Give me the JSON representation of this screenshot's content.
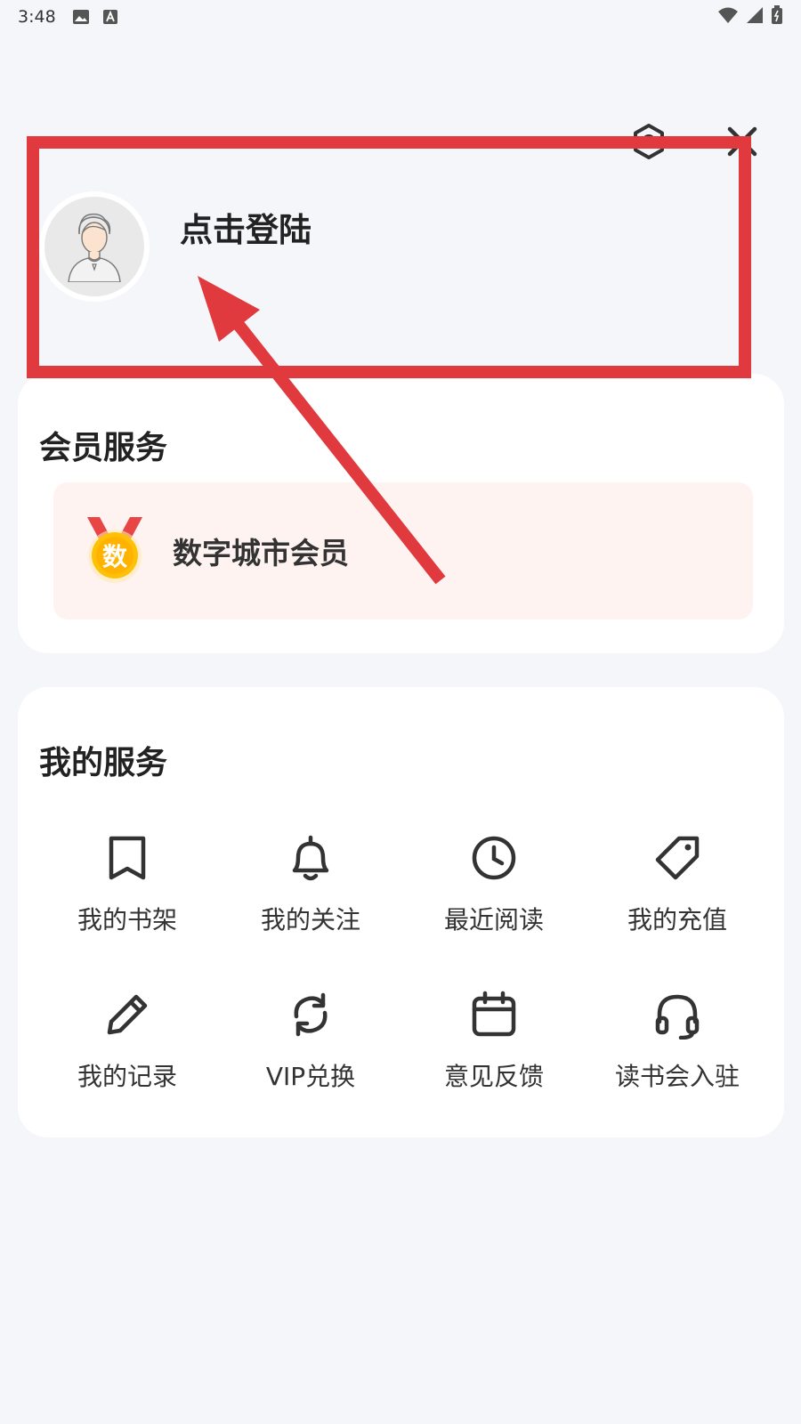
{
  "status_bar": {
    "time": "3:48"
  },
  "header": {
    "login_text": "点击登陆"
  },
  "member_section": {
    "title": "会员服务",
    "item_label": "数字城市会员",
    "medal_char": "数"
  },
  "services": {
    "title": "我的服务",
    "items": [
      {
        "label": "我的书架",
        "icon": "bookmark-icon"
      },
      {
        "label": "我的关注",
        "icon": "bell-icon"
      },
      {
        "label": "最近阅读",
        "icon": "clock-icon"
      },
      {
        "label": "我的充值",
        "icon": "tag-icon"
      },
      {
        "label": "我的记录",
        "icon": "pencil-icon"
      },
      {
        "label": "VIP兑换",
        "icon": "refresh-icon"
      },
      {
        "label": "意见反馈",
        "icon": "calendar-icon"
      },
      {
        "label": "读书会入驻",
        "icon": "headphones-icon"
      }
    ]
  },
  "colors": {
    "background": "#f5f6fa",
    "card": "#ffffff",
    "member_bg": "#fff3f2",
    "annotation": "#e0393e",
    "medal_gold": "#ffc107",
    "ribbon_red": "#e84545"
  }
}
